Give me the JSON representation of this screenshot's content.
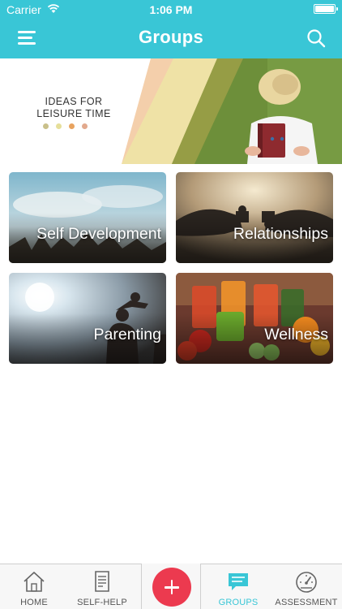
{
  "status": {
    "carrier": "Carrier",
    "time": "1:06 PM"
  },
  "header": {
    "title": "Groups"
  },
  "banner": {
    "line1": "IDEAS FOR",
    "line2": "LEISURE TIME",
    "dot_colors": [
      "#c9c08a",
      "#e6df9a",
      "#e8a35f",
      "#e2a98d"
    ]
  },
  "groups": [
    {
      "label": "Self Development"
    },
    {
      "label": "Relationships"
    },
    {
      "label": "Parenting"
    },
    {
      "label": "Wellness"
    }
  ],
  "tabs": [
    {
      "label": "HOME",
      "icon": "home-icon"
    },
    {
      "label": "SELF-HELP",
      "icon": "document-icon"
    },
    {
      "label": "GROUPS",
      "icon": "chat-icon"
    },
    {
      "label": "ASSESSMENT",
      "icon": "speedometer-icon"
    }
  ],
  "colors": {
    "accent": "#39c6d6",
    "add_button": "#ec3a4f"
  }
}
